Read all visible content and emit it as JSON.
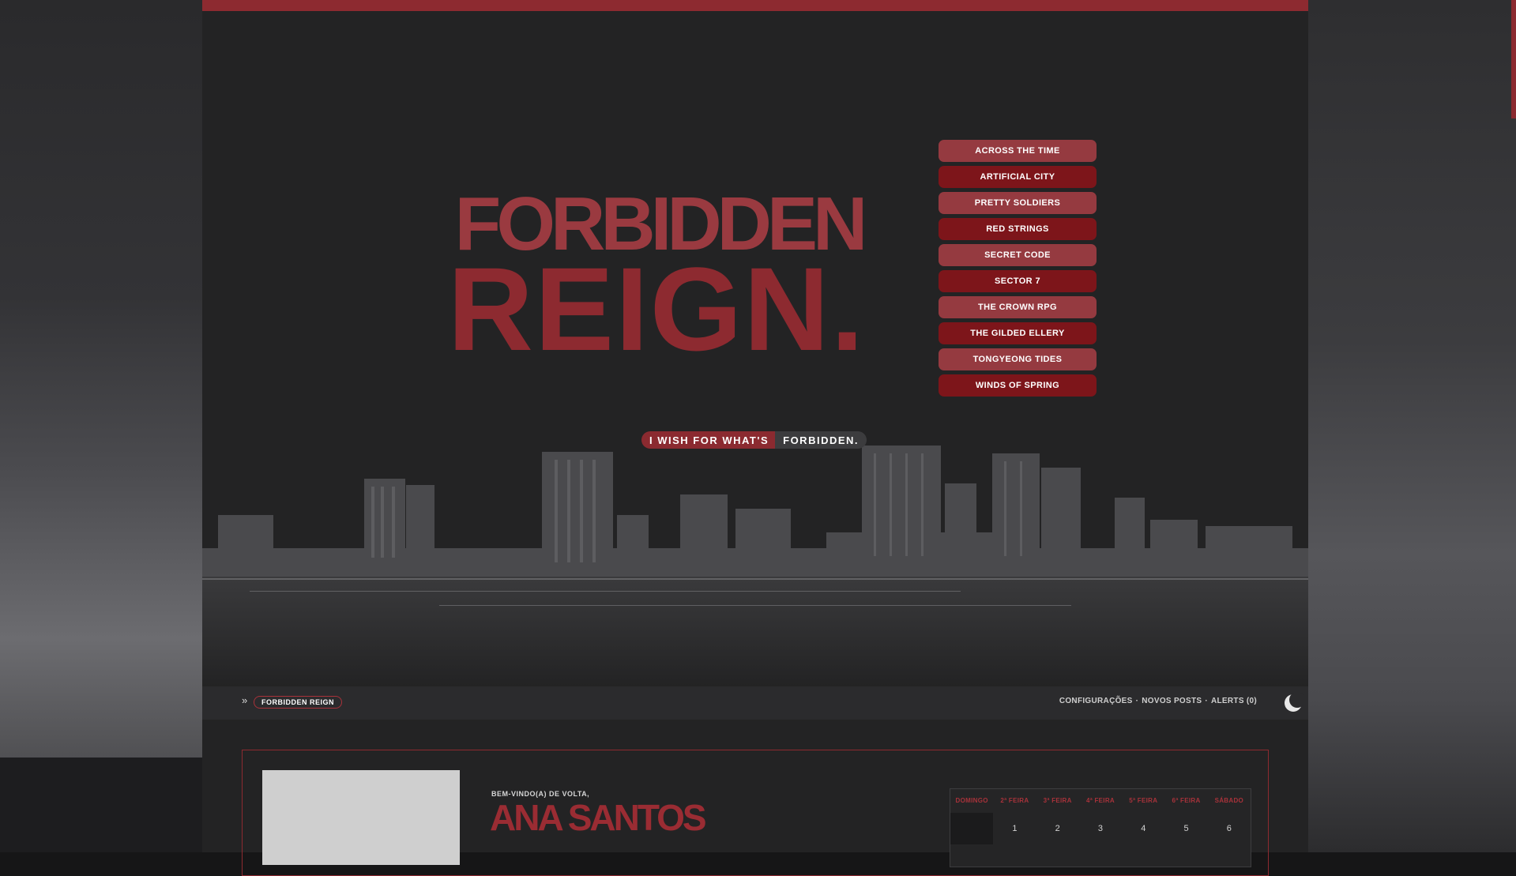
{
  "site": {
    "title_line1": "FORBIDDEN",
    "title_line2": "REIGN.",
    "tagline_part1": "I WISH FOR WHAT'S",
    "tagline_part2": "FORBIDDEN."
  },
  "nav": {
    "items": [
      {
        "label": "ACROSS THE TIME"
      },
      {
        "label": "ARTIFICIAL CITY"
      },
      {
        "label": "PRETTY SOLDIERS"
      },
      {
        "label": "RED STRINGS"
      },
      {
        "label": "SECRET CODE"
      },
      {
        "label": "SECTOR 7"
      },
      {
        "label": "THE CROWN RPG"
      },
      {
        "label": "THE GILDED ELLERY"
      },
      {
        "label": "TONGYEONG TIDES"
      },
      {
        "label": "WINDS OF SPRING"
      }
    ]
  },
  "breadcrumb": {
    "arrow": "»",
    "label": "FORBIDDEN REIGN"
  },
  "userbar": {
    "settings": "CONFIGURAÇÕES",
    "sep1": "·",
    "new_posts": "NOVOS POSTS",
    "sep2": "·",
    "alerts": "ALERTS (0)"
  },
  "welcome": {
    "greeting": "BEM-VINDO(A) DE VOLTA,",
    "name": "ANA SANTOS"
  },
  "calendar": {
    "weekdays": [
      "DOMINGO",
      "2ª FEIRA",
      "3ª FEIRA",
      "4ª FEIRA",
      "5ª FEIRA",
      "6ª FEIRA",
      "SÁBADO"
    ],
    "week1": [
      "",
      "1",
      "2",
      "3",
      "4",
      "5",
      "6"
    ]
  },
  "colors": {
    "accent": "#8d2a30",
    "accent_light": "#953a40",
    "accent_dark": "#7d151a",
    "background": "#232324"
  },
  "icons": {
    "theme_toggle": "moon-icon"
  }
}
